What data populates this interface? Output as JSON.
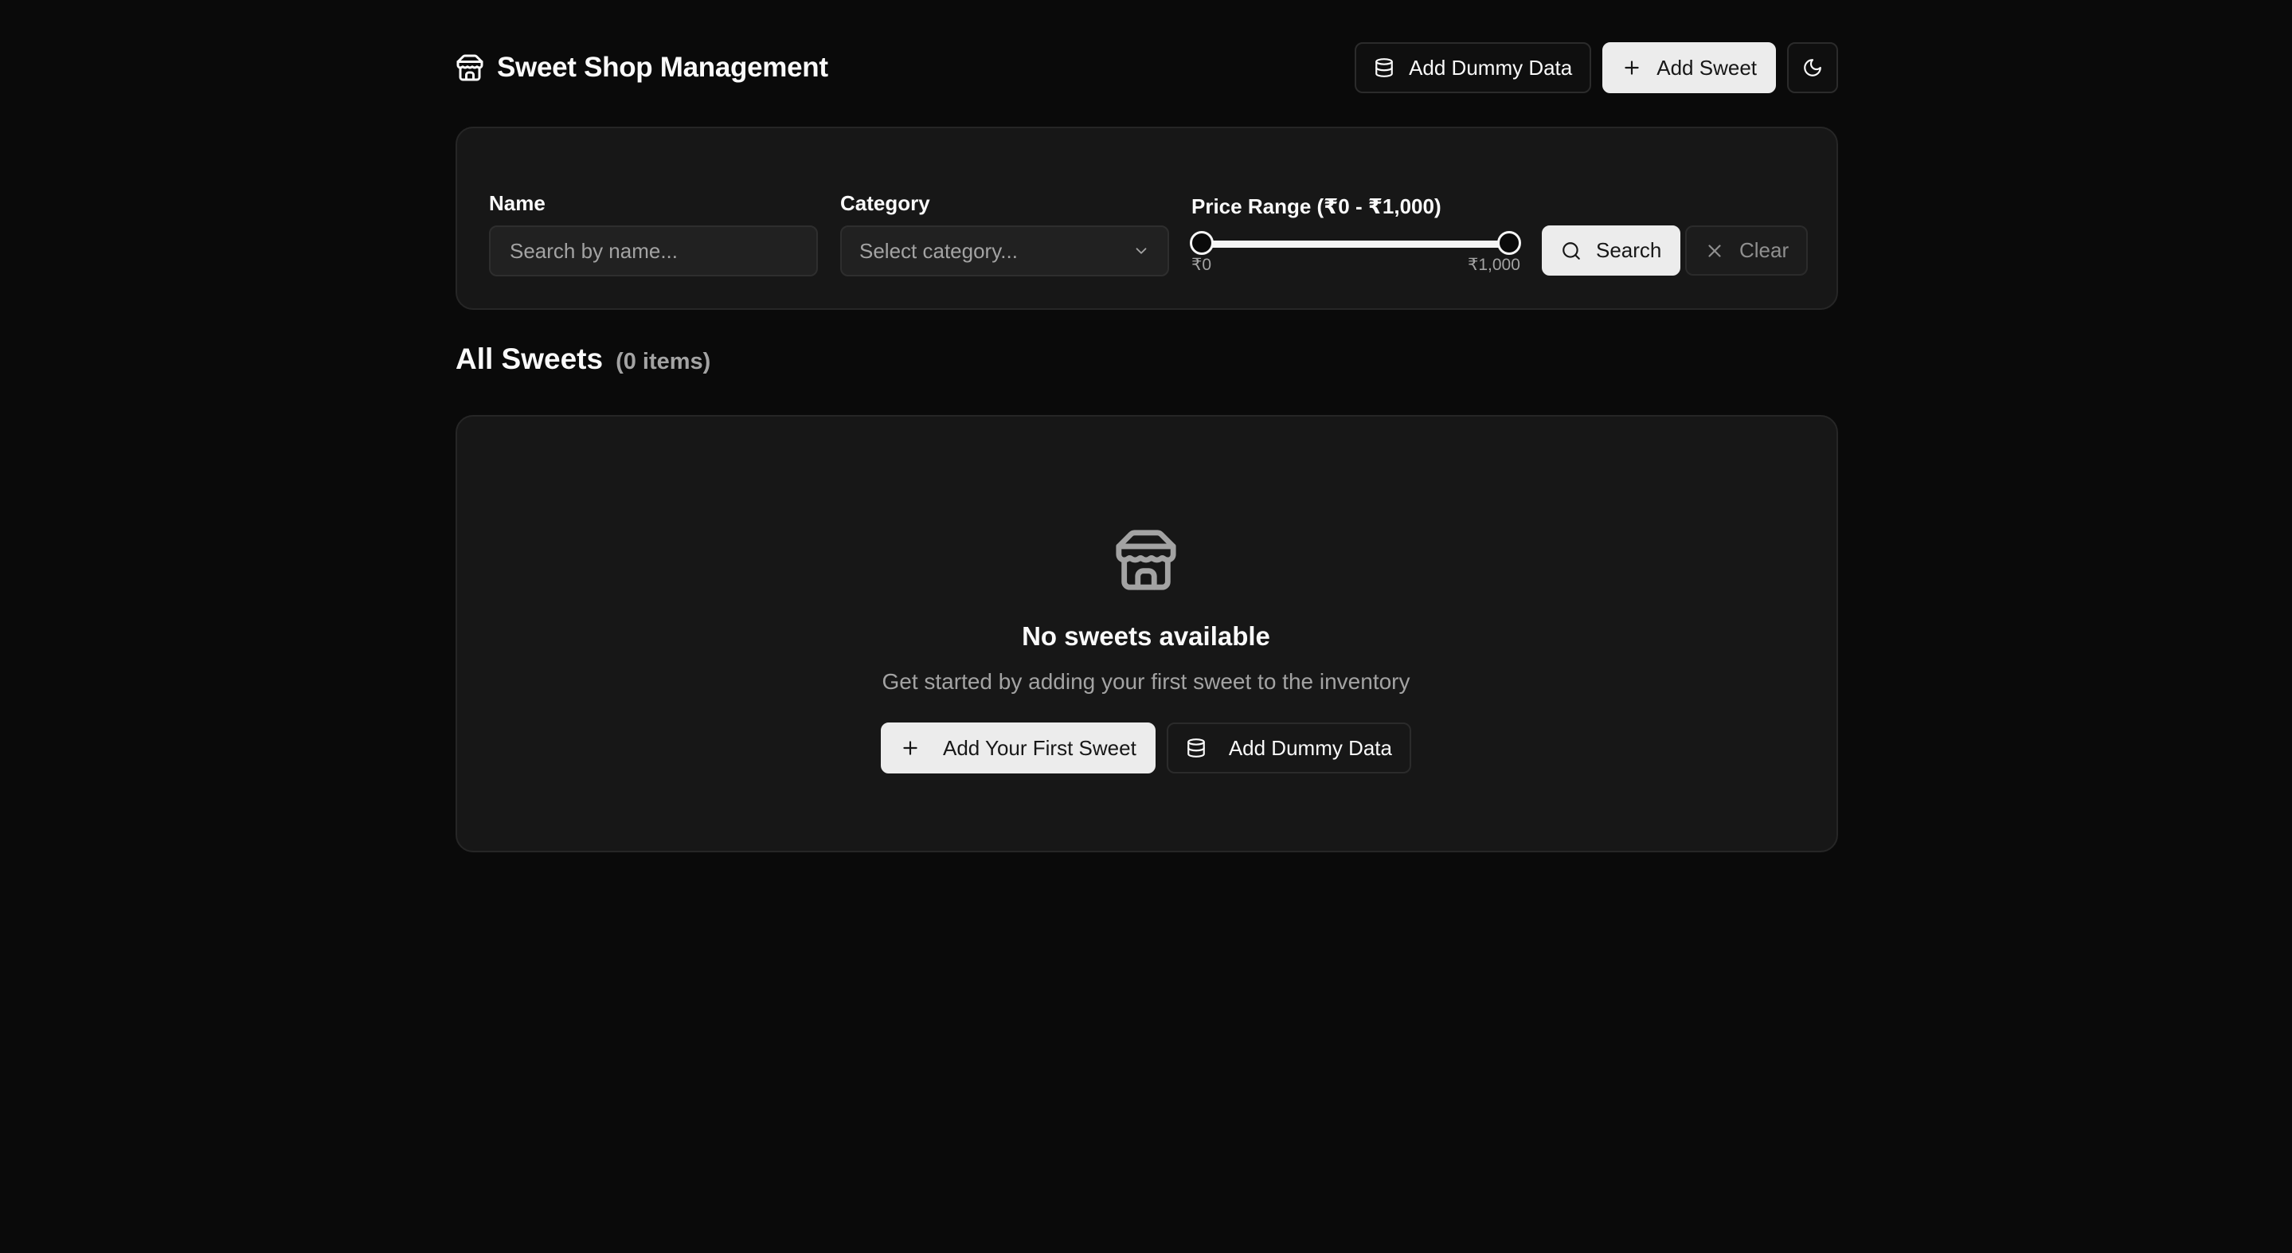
{
  "header": {
    "title": "Sweet Shop Management",
    "brand_icon": "store-icon",
    "add_dummy_label": "Add Dummy Data",
    "add_sweet_label": "Add Sweet",
    "theme_toggle_icon": "moon-icon"
  },
  "filters": {
    "name_label": "Name",
    "name_placeholder": "Search by name...",
    "name_value": "",
    "category_label": "Category",
    "category_placeholder": "Select category...",
    "price_label": "Price Range (₹0 - ₹1,000)",
    "price_min_label": "₹0",
    "price_max_label": "₹1,000",
    "price_range": [
      0,
      1000
    ],
    "search_label": "Search",
    "clear_label": "Clear"
  },
  "list": {
    "title": "All Sweets",
    "count_text": "(0 items)"
  },
  "empty_state": {
    "icon": "store-icon",
    "title": "No sweets available",
    "description": "Get started by adding your first sweet to the inventory",
    "add_first_label": "Add Your First Sweet",
    "add_dummy_label": "Add Dummy Data"
  },
  "colors": {
    "background": "#0a0a0a",
    "card": "#171717",
    "border": "#262626",
    "primary_button": "#ececec",
    "muted_text": "#a3a3a3"
  }
}
